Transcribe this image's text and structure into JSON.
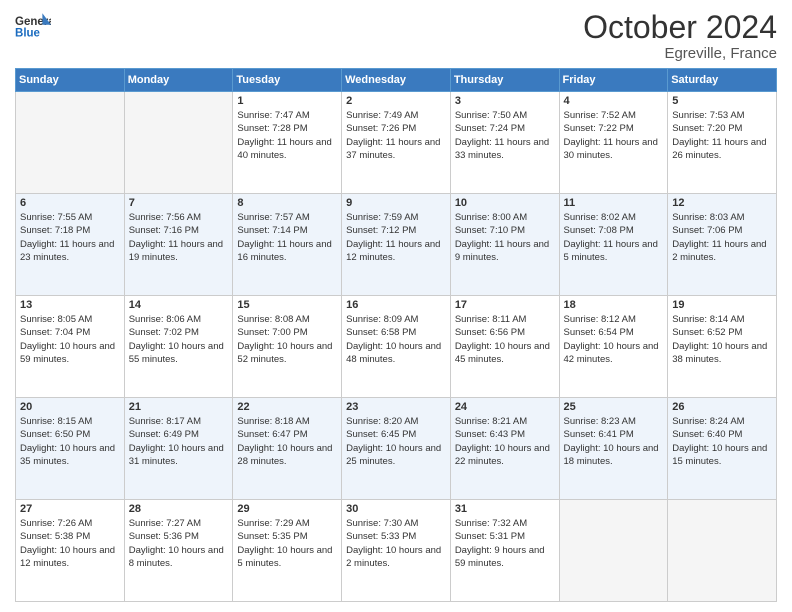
{
  "header": {
    "logo_general": "General",
    "logo_blue": "Blue",
    "month": "October 2024",
    "location": "Egreville, France"
  },
  "days_of_week": [
    "Sunday",
    "Monday",
    "Tuesday",
    "Wednesday",
    "Thursday",
    "Friday",
    "Saturday"
  ],
  "weeks": [
    [
      {
        "day": "",
        "info": ""
      },
      {
        "day": "",
        "info": ""
      },
      {
        "day": "1",
        "info": "Sunrise: 7:47 AM\nSunset: 7:28 PM\nDaylight: 11 hours and 40 minutes."
      },
      {
        "day": "2",
        "info": "Sunrise: 7:49 AM\nSunset: 7:26 PM\nDaylight: 11 hours and 37 minutes."
      },
      {
        "day": "3",
        "info": "Sunrise: 7:50 AM\nSunset: 7:24 PM\nDaylight: 11 hours and 33 minutes."
      },
      {
        "day": "4",
        "info": "Sunrise: 7:52 AM\nSunset: 7:22 PM\nDaylight: 11 hours and 30 minutes."
      },
      {
        "day": "5",
        "info": "Sunrise: 7:53 AM\nSunset: 7:20 PM\nDaylight: 11 hours and 26 minutes."
      }
    ],
    [
      {
        "day": "6",
        "info": "Sunrise: 7:55 AM\nSunset: 7:18 PM\nDaylight: 11 hours and 23 minutes."
      },
      {
        "day": "7",
        "info": "Sunrise: 7:56 AM\nSunset: 7:16 PM\nDaylight: 11 hours and 19 minutes."
      },
      {
        "day": "8",
        "info": "Sunrise: 7:57 AM\nSunset: 7:14 PM\nDaylight: 11 hours and 16 minutes."
      },
      {
        "day": "9",
        "info": "Sunrise: 7:59 AM\nSunset: 7:12 PM\nDaylight: 11 hours and 12 minutes."
      },
      {
        "day": "10",
        "info": "Sunrise: 8:00 AM\nSunset: 7:10 PM\nDaylight: 11 hours and 9 minutes."
      },
      {
        "day": "11",
        "info": "Sunrise: 8:02 AM\nSunset: 7:08 PM\nDaylight: 11 hours and 5 minutes."
      },
      {
        "day": "12",
        "info": "Sunrise: 8:03 AM\nSunset: 7:06 PM\nDaylight: 11 hours and 2 minutes."
      }
    ],
    [
      {
        "day": "13",
        "info": "Sunrise: 8:05 AM\nSunset: 7:04 PM\nDaylight: 10 hours and 59 minutes."
      },
      {
        "day": "14",
        "info": "Sunrise: 8:06 AM\nSunset: 7:02 PM\nDaylight: 10 hours and 55 minutes."
      },
      {
        "day": "15",
        "info": "Sunrise: 8:08 AM\nSunset: 7:00 PM\nDaylight: 10 hours and 52 minutes."
      },
      {
        "day": "16",
        "info": "Sunrise: 8:09 AM\nSunset: 6:58 PM\nDaylight: 10 hours and 48 minutes."
      },
      {
        "day": "17",
        "info": "Sunrise: 8:11 AM\nSunset: 6:56 PM\nDaylight: 10 hours and 45 minutes."
      },
      {
        "day": "18",
        "info": "Sunrise: 8:12 AM\nSunset: 6:54 PM\nDaylight: 10 hours and 42 minutes."
      },
      {
        "day": "19",
        "info": "Sunrise: 8:14 AM\nSunset: 6:52 PM\nDaylight: 10 hours and 38 minutes."
      }
    ],
    [
      {
        "day": "20",
        "info": "Sunrise: 8:15 AM\nSunset: 6:50 PM\nDaylight: 10 hours and 35 minutes."
      },
      {
        "day": "21",
        "info": "Sunrise: 8:17 AM\nSunset: 6:49 PM\nDaylight: 10 hours and 31 minutes."
      },
      {
        "day": "22",
        "info": "Sunrise: 8:18 AM\nSunset: 6:47 PM\nDaylight: 10 hours and 28 minutes."
      },
      {
        "day": "23",
        "info": "Sunrise: 8:20 AM\nSunset: 6:45 PM\nDaylight: 10 hours and 25 minutes."
      },
      {
        "day": "24",
        "info": "Sunrise: 8:21 AM\nSunset: 6:43 PM\nDaylight: 10 hours and 22 minutes."
      },
      {
        "day": "25",
        "info": "Sunrise: 8:23 AM\nSunset: 6:41 PM\nDaylight: 10 hours and 18 minutes."
      },
      {
        "day": "26",
        "info": "Sunrise: 8:24 AM\nSunset: 6:40 PM\nDaylight: 10 hours and 15 minutes."
      }
    ],
    [
      {
        "day": "27",
        "info": "Sunrise: 7:26 AM\nSunset: 5:38 PM\nDaylight: 10 hours and 12 minutes."
      },
      {
        "day": "28",
        "info": "Sunrise: 7:27 AM\nSunset: 5:36 PM\nDaylight: 10 hours and 8 minutes."
      },
      {
        "day": "29",
        "info": "Sunrise: 7:29 AM\nSunset: 5:35 PM\nDaylight: 10 hours and 5 minutes."
      },
      {
        "day": "30",
        "info": "Sunrise: 7:30 AM\nSunset: 5:33 PM\nDaylight: 10 hours and 2 minutes."
      },
      {
        "day": "31",
        "info": "Sunrise: 7:32 AM\nSunset: 5:31 PM\nDaylight: 9 hours and 59 minutes."
      },
      {
        "day": "",
        "info": ""
      },
      {
        "day": "",
        "info": ""
      }
    ]
  ]
}
